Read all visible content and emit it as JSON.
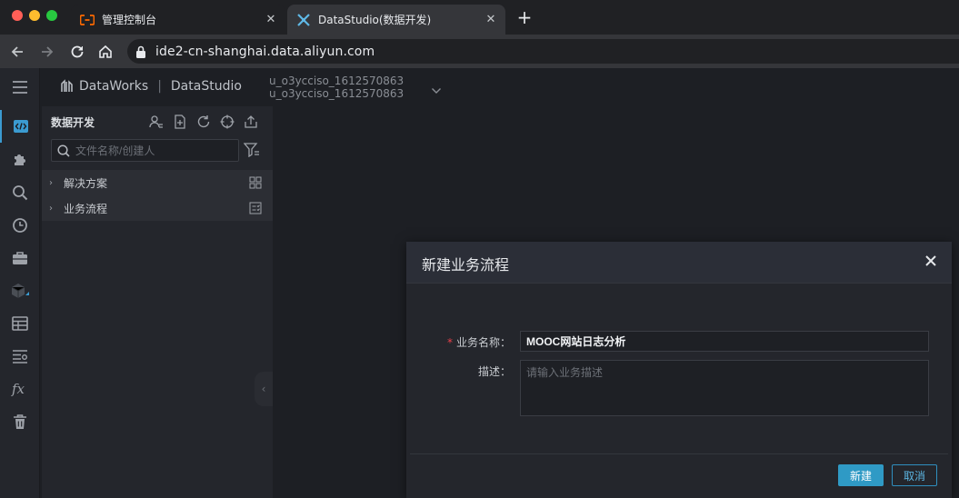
{
  "browser": {
    "tabs": [
      {
        "label": "管理控制台",
        "favicon": "aliyun-logo-icon",
        "active": false
      },
      {
        "label": "DataStudio(数据开发)",
        "favicon": "datastudio-logo-icon",
        "active": true
      }
    ],
    "url": "ide2-cn-shanghai.data.aliyun.com"
  },
  "app": {
    "brand": "DataWorks",
    "module": "DataStudio",
    "workspace_line1": "u_o3ycciso_1612570863",
    "workspace_line2": "u_o3ycciso_1612570863"
  },
  "leftnav": {
    "icons": [
      "menu-icon",
      "code-icon",
      "puzzle-icon",
      "search-icon",
      "clock-icon",
      "briefcase-icon",
      "cube-icon",
      "table-icon",
      "list-settings-icon",
      "function-icon",
      "trash-icon"
    ]
  },
  "panel": {
    "title": "数据开发",
    "search_placeholder": "文件名称/创建人",
    "tree": [
      {
        "label": "解决方案"
      },
      {
        "label": "业务流程"
      }
    ]
  },
  "modal": {
    "title": "新建业务流程",
    "name_label": "业务名称：",
    "name_required_mark": "*",
    "name_value": "MOOC网站日志分析",
    "desc_label": "描述：",
    "desc_placeholder": "请输入业务描述",
    "confirm_label": "新建",
    "cancel_label": "取消"
  },
  "colors": {
    "accent": "#2f9ac5",
    "required": "#e8404a"
  }
}
